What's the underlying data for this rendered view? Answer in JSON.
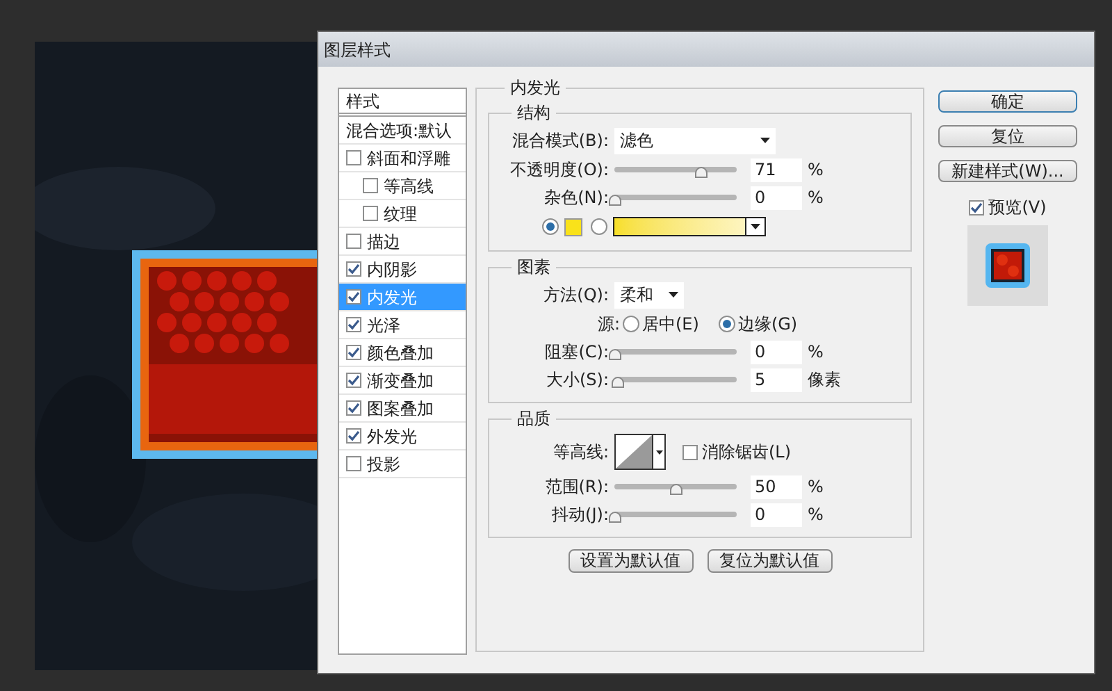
{
  "window": {
    "title": "图层样式"
  },
  "styles_panel": {
    "header": "样式",
    "items": [
      {
        "label": "混合选项:默认",
        "kind": "plain",
        "selected": false
      },
      {
        "label": "斜面和浮雕",
        "kind": "checkbox",
        "checked": false,
        "selected": false,
        "children": [
          {
            "label": "等高线",
            "kind": "checkbox",
            "checked": false,
            "selected": false
          },
          {
            "label": "纹理",
            "kind": "checkbox",
            "checked": false,
            "selected": false
          }
        ]
      },
      {
        "label": "描边",
        "kind": "checkbox",
        "checked": false,
        "selected": false
      },
      {
        "label": "内阴影",
        "kind": "checkbox",
        "checked": true,
        "selected": false
      },
      {
        "label": "内发光",
        "kind": "checkbox",
        "checked": true,
        "selected": true
      },
      {
        "label": "光泽",
        "kind": "checkbox",
        "checked": true,
        "selected": false
      },
      {
        "label": "颜色叠加",
        "kind": "checkbox",
        "checked": true,
        "selected": false
      },
      {
        "label": "渐变叠加",
        "kind": "checkbox",
        "checked": true,
        "selected": false
      },
      {
        "label": "图案叠加",
        "kind": "checkbox",
        "checked": true,
        "selected": false
      },
      {
        "label": "外发光",
        "kind": "checkbox",
        "checked": true,
        "selected": false
      },
      {
        "label": "投影",
        "kind": "checkbox",
        "checked": false,
        "selected": false
      }
    ]
  },
  "inner_glow": {
    "title": "内发光",
    "structure": {
      "title": "结构",
      "blend_mode": {
        "label": "混合模式(B):",
        "value": "滤色"
      },
      "sliders": [
        {
          "label": "不透明度(O):",
          "level": 0.71,
          "value": "71",
          "unit": "%"
        },
        {
          "label": "杂色(N):",
          "level": 0,
          "value": "0",
          "unit": "%"
        }
      ],
      "fill_options": [
        {
          "kind": "color",
          "selected": true
        },
        {
          "kind": "gradient",
          "selected": false
        }
      ]
    },
    "elements": {
      "title": "图素",
      "method": {
        "label": "方法(Q):",
        "value": "柔和"
      },
      "source": {
        "label": "源:",
        "options": [
          {
            "label": "居中(E)",
            "selected": false
          },
          {
            "label": "边缘(G)",
            "selected": true
          }
        ]
      },
      "sliders": [
        {
          "label": "阻塞(C):",
          "level": 0,
          "value": "0",
          "unit": "%"
        },
        {
          "label": "大小(S):",
          "level": 0.02,
          "value": "5",
          "unit": "像素"
        }
      ]
    },
    "quality": {
      "title": "品质",
      "contour": {
        "label": "等高线:"
      },
      "anti_alias": {
        "label": "消除锯齿(L)",
        "checked": false
      },
      "sliders": [
        {
          "label": "范围(R):",
          "level": 0.5,
          "value": "50",
          "unit": "%"
        },
        {
          "label": "抖动(J):",
          "level": 0,
          "value": "0",
          "unit": "%"
        }
      ]
    },
    "buttons": [
      "设置为默认值",
      "复位为默认值"
    ]
  },
  "actions": {
    "buttons": [
      {
        "label": "确定",
        "kind": "default"
      },
      {
        "label": "复位",
        "kind": "normal"
      },
      {
        "label": "新建样式(W)...",
        "kind": "normal"
      }
    ],
    "preview": {
      "label": "预览(V)",
      "checked": true
    }
  }
}
